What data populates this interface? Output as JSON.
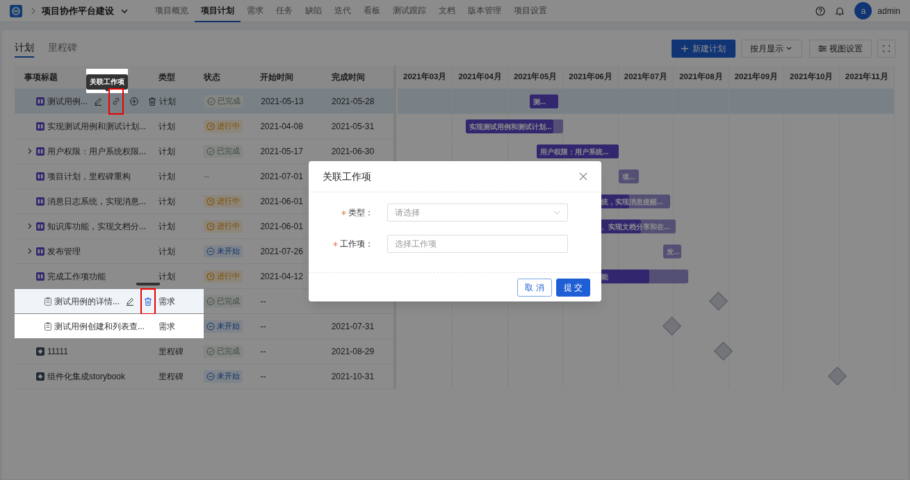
{
  "topbar": {
    "project": "项目协作平台建设",
    "nav": [
      {
        "label": "项目概览",
        "selected": false
      },
      {
        "label": "项目计划",
        "selected": true
      },
      {
        "label": "需求",
        "selected": false
      },
      {
        "label": "任务",
        "selected": false
      },
      {
        "label": "缺陷",
        "selected": false
      },
      {
        "label": "迭代",
        "selected": false
      },
      {
        "label": "看板",
        "selected": false
      },
      {
        "label": "测试跟踪",
        "selected": false
      },
      {
        "label": "文档",
        "selected": false
      },
      {
        "label": "版本管理",
        "selected": false
      },
      {
        "label": "项目设置",
        "selected": false
      }
    ],
    "avatar": "a",
    "user": "admin"
  },
  "tabs": [
    {
      "label": "计划",
      "selected": true
    },
    {
      "label": "里程碑",
      "selected": false
    }
  ],
  "toolbar": {
    "new_button": "新建计划",
    "view_select": "按月显示",
    "settings_button": "视图设置"
  },
  "table": {
    "columns": [
      "事项标题",
      "类型",
      "状态",
      "开始时间",
      "完成时间"
    ],
    "rows": [
      {
        "kind": "plan",
        "title": "测试用例...",
        "type": "计划",
        "status": {
          "kind": "done",
          "label": "已完成"
        },
        "start": "2021-05-13",
        "end": "2021-05-28",
        "selected": true,
        "spotlight": false,
        "actions": [
          {
            "kind": "edit",
            "marked": false
          },
          {
            "kind": "link",
            "marked": true,
            "tooltip": "关联工作项"
          },
          {
            "kind": "add",
            "marked": false
          },
          {
            "kind": "delete",
            "marked": false
          }
        ],
        "bar": {
          "kind": "range",
          "level": 1,
          "label": "测..."
        }
      },
      {
        "kind": "plan",
        "title": "实现测试用例和测试计划...",
        "type": "计划",
        "status": {
          "kind": "progress",
          "label": "进行中"
        },
        "start": "2021-04-08",
        "end": "2021-05-31",
        "selected": false,
        "spotlight": false,
        "bar": {
          "kind": "range",
          "level": 0.9,
          "label": "实现测试用例和测试计划..."
        }
      },
      {
        "kind": "plan",
        "title": "用户权限：用户系统权限...",
        "type": "计划",
        "status": {
          "kind": "done",
          "label": "已完成"
        },
        "start": "2021-05-17",
        "end": "2021-06-30",
        "selected": false,
        "spotlight": false,
        "expanded": false,
        "bar": {
          "kind": "range",
          "level": 1,
          "label": "用户权限：用户系统..."
        }
      },
      {
        "kind": "plan",
        "title": "项目计划，里程碑重构",
        "type": "计划",
        "status": {
          "kind": "none",
          "label": "--"
        },
        "start": "2021-07-01",
        "selected": false,
        "spotlight": false,
        "bar": {
          "kind": "range",
          "level": 0,
          "label": "项..."
        }
      },
      {
        "kind": "plan",
        "title": "消息日志系统，实现消息...",
        "type": "计划",
        "status": {
          "kind": "progress",
          "label": "进行中"
        },
        "start": "2021-06-01",
        "selected": false,
        "spotlight": false,
        "bar": {
          "kind": "range",
          "level": 0.62,
          "label": "统，实现消息提醒..."
        }
      },
      {
        "kind": "plan",
        "title": "知识库功能，实现文档分...",
        "type": "计划",
        "status": {
          "kind": "progress",
          "label": "进行中"
        },
        "start": "2021-06-01",
        "selected": false,
        "spotlight": false,
        "expanded": false,
        "bar": {
          "kind": "range",
          "level": 0.69,
          "label": "、实现文档分享和在..."
        }
      },
      {
        "kind": "plan",
        "title": "发布管理",
        "type": "计划",
        "status": {
          "kind": "todo",
          "label": "未开始"
        },
        "start": "2021-07-26",
        "selected": false,
        "spotlight": false,
        "expanded": false,
        "bar": {
          "kind": "range",
          "level": 0,
          "label": "发..."
        }
      },
      {
        "kind": "plan",
        "title": "完成工作项功能",
        "type": "计划",
        "status": {
          "kind": "progress",
          "label": "进行中"
        },
        "start": "2021-04-12",
        "selected": false,
        "spotlight": false,
        "bar": {
          "kind": "range",
          "level": 0.82,
          "label": "能"
        },
        "children": [
          {
            "kind": "requirement",
            "title": "测试用例的详情...",
            "type": "需求",
            "status": {
              "kind": "done",
              "label": "已完成"
            },
            "start": "--",
            "selected": false,
            "spotlight": true,
            "hovered": true,
            "actions": [
              {
                "kind": "edit",
                "marked": false
              },
              {
                "kind": "delete",
                "marked": true,
                "tooltip_stub": true
              }
            ],
            "bar": {
              "kind": "milestone"
            }
          },
          {
            "kind": "requirement",
            "title": "测试用例创建和列表查...",
            "type": "需求",
            "status": {
              "kind": "todo",
              "label": "未开始"
            },
            "start": "--",
            "end": "2021-07-31",
            "selected": false,
            "spotlight": true,
            "hovered": false,
            "bar": {
              "kind": "milestone"
            }
          }
        ]
      },
      {
        "kind": "milestone",
        "title": "11111",
        "type": "里程碑",
        "status": {
          "kind": "done",
          "label": "已完成"
        },
        "start": "--",
        "end": "2021-08-29",
        "selected": false,
        "spotlight": false,
        "bar": {
          "kind": "milestone"
        }
      },
      {
        "kind": "milestone",
        "title": "组件化集成storybook",
        "type": "里程碑",
        "status": {
          "kind": "todo",
          "label": "未开始"
        },
        "start": "--",
        "end": "2021-10-31",
        "selected": false,
        "spotlight": false,
        "bar": {
          "kind": "milestone"
        }
      }
    ]
  },
  "timeline": {
    "months": [
      "2021年03月",
      "2021年04月",
      "2021年05月",
      "2021年06月",
      "2021年07月",
      "2021年08月",
      "2021年09月",
      "2021年10月",
      "2021年11月"
    ]
  },
  "dialog": {
    "title": "关联工作项",
    "fields": [
      {
        "kind": "select",
        "label": "类型：",
        "required": true,
        "placeholder": "请选择"
      },
      {
        "kind": "input",
        "label": "工作项：",
        "required": true,
        "placeholder": "选择工作项"
      }
    ],
    "buttons": [
      {
        "kind": "secondary",
        "label": "取 消"
      },
      {
        "kind": "primary",
        "label": "提 交"
      }
    ]
  }
}
